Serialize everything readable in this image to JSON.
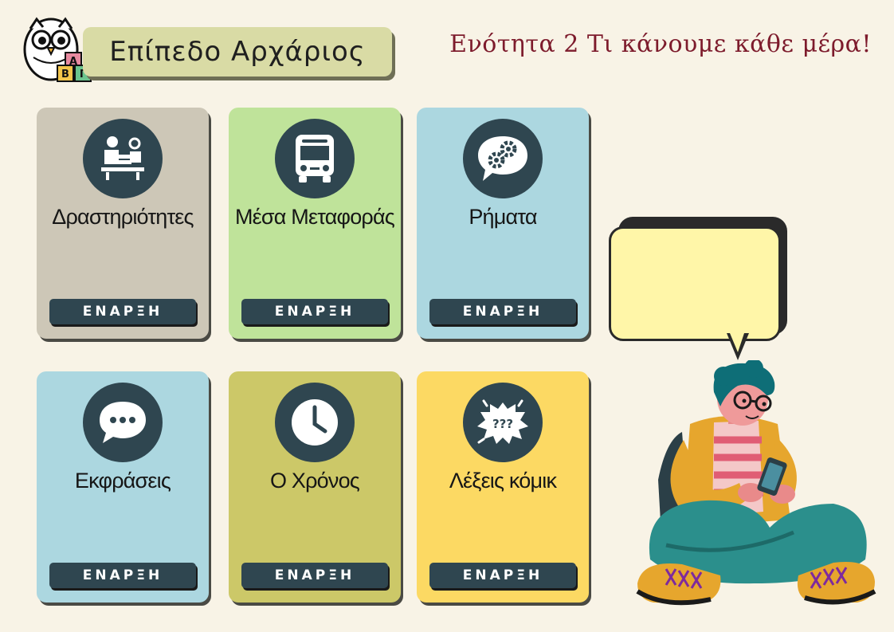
{
  "header": {
    "level_title": "Επίπεδο Αρχάριος",
    "unit_title": "Ενότητα 2 Τι κάνουμε κάθε μέρα!",
    "logo_letters": [
      "A",
      "B",
      "Γ"
    ]
  },
  "cards": [
    {
      "label": "Δραστηριότητες",
      "button": "ΕΝΑΡΞΗ",
      "icon": "activities-icon",
      "color": "#cdc7b7"
    },
    {
      "label": "Μέσα Μεταφοράς",
      "button": "ΕΝΑΡΞΗ",
      "icon": "bus-icon",
      "color": "#bfe39a"
    },
    {
      "label": "Ρήματα",
      "button": "ΕΝΑΡΞΗ",
      "icon": "gears-speech-icon",
      "color": "#acd7e0"
    },
    {
      "label": "Εκφράσεις",
      "button": "ΕΝΑΡΞΗ",
      "icon": "chat-bubble-icon",
      "color": "#acd7e0"
    },
    {
      "label": "Ο Χρόνος",
      "button": "ΕΝΑΡΞΗ",
      "icon": "clock-icon",
      "color": "#ccc868"
    },
    {
      "label": "Λέξεις κόμικ",
      "button": "ΕΝΑΡΞΗ",
      "icon": "comic-burst-icon",
      "color": "#fcd963"
    }
  ],
  "speech_bubble": {
    "text": ""
  },
  "colors": {
    "background": "#f8f3e6",
    "button": "#2f4650",
    "unit_title": "#7d1b2c",
    "level_pill": "#d9dba5"
  }
}
